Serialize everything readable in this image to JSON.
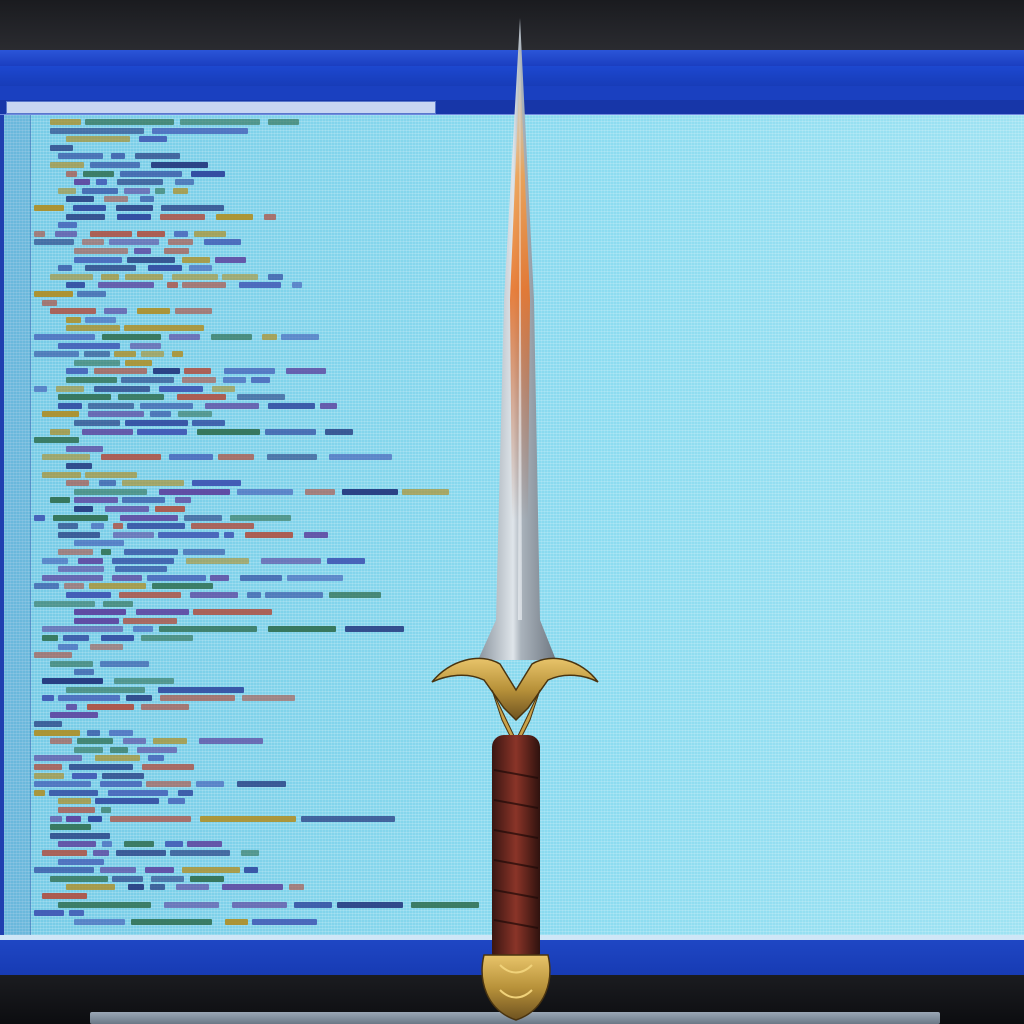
{
  "image": {
    "subject": "",
    "colors": {
      "screen_chrome": "#1f3fb0",
      "editor_background": "#8ddcf0",
      "blade_glow": "#e8742a",
      "blade_steel": "#b9c2cc",
      "guard_gold": "#b8923a",
      "grip_red": "#7a2a22"
    }
  },
  "window": {
    "title": "",
    "menu": "",
    "toolbar": "",
    "tab_label": ""
  },
  "status": {
    "left": "",
    "tray": ""
  }
}
